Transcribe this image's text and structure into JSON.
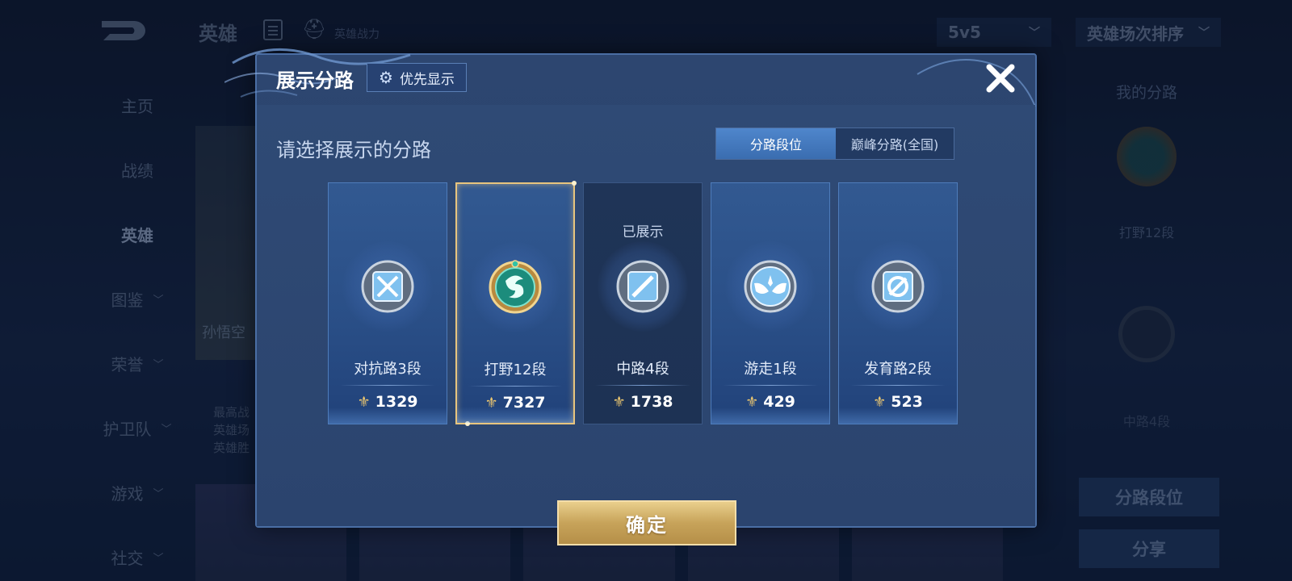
{
  "background": {
    "nav_title": "英雄",
    "power_label": "英雄战力",
    "mode_select": "5v5",
    "sort_select": "英雄场次排序",
    "sidebar": [
      {
        "label": "主页",
        "has_chevron": false
      },
      {
        "label": "战绩",
        "has_chevron": false
      },
      {
        "label": "英雄",
        "has_chevron": false,
        "active": true
      },
      {
        "label": "图鉴",
        "has_chevron": true
      },
      {
        "label": "荣誉",
        "has_chevron": true
      },
      {
        "label": "护卫队",
        "has_chevron": true
      },
      {
        "label": "游戏",
        "has_chevron": true
      },
      {
        "label": "社交",
        "has_chevron": true
      }
    ],
    "hero_name": "孙悟空",
    "hero_stats": [
      "最高战",
      "英雄场",
      "英雄胜"
    ],
    "right_panel": {
      "title": "我的分路",
      "lane1": "打野12段",
      "lane2": "中路4段",
      "btn_rank": "分路段位",
      "btn_share": "分享"
    }
  },
  "modal": {
    "title": "展示分路",
    "priority_button": "优先显示",
    "subtitle": "请选择展示的分路",
    "tabs": [
      {
        "label": "分路段位",
        "active": true
      },
      {
        "label": "巅峰分路(全国)",
        "active": false
      }
    ],
    "cards": [
      {
        "label": "对抗路3段",
        "score": "1329",
        "icon": "clash-lane-icon",
        "selected": false,
        "shown": false
      },
      {
        "label": "打野12段",
        "score": "7327",
        "icon": "jungle-dragon-icon",
        "selected": true,
        "shown": false
      },
      {
        "label": "中路4段",
        "score": "1738",
        "icon": "mid-lane-icon",
        "selected": false,
        "shown": true,
        "shown_label": "已展示"
      },
      {
        "label": "游走1段",
        "score": "429",
        "icon": "roam-wings-icon",
        "selected": false,
        "shown": false
      },
      {
        "label": "发育路2段",
        "score": "523",
        "icon": "farm-lane-icon",
        "selected": false,
        "shown": false
      }
    ],
    "confirm_button": "确定"
  },
  "colors": {
    "accent_gold": "#e8c57e",
    "tab_active": "#3a6db0",
    "modal_bg": "#2d4670"
  }
}
